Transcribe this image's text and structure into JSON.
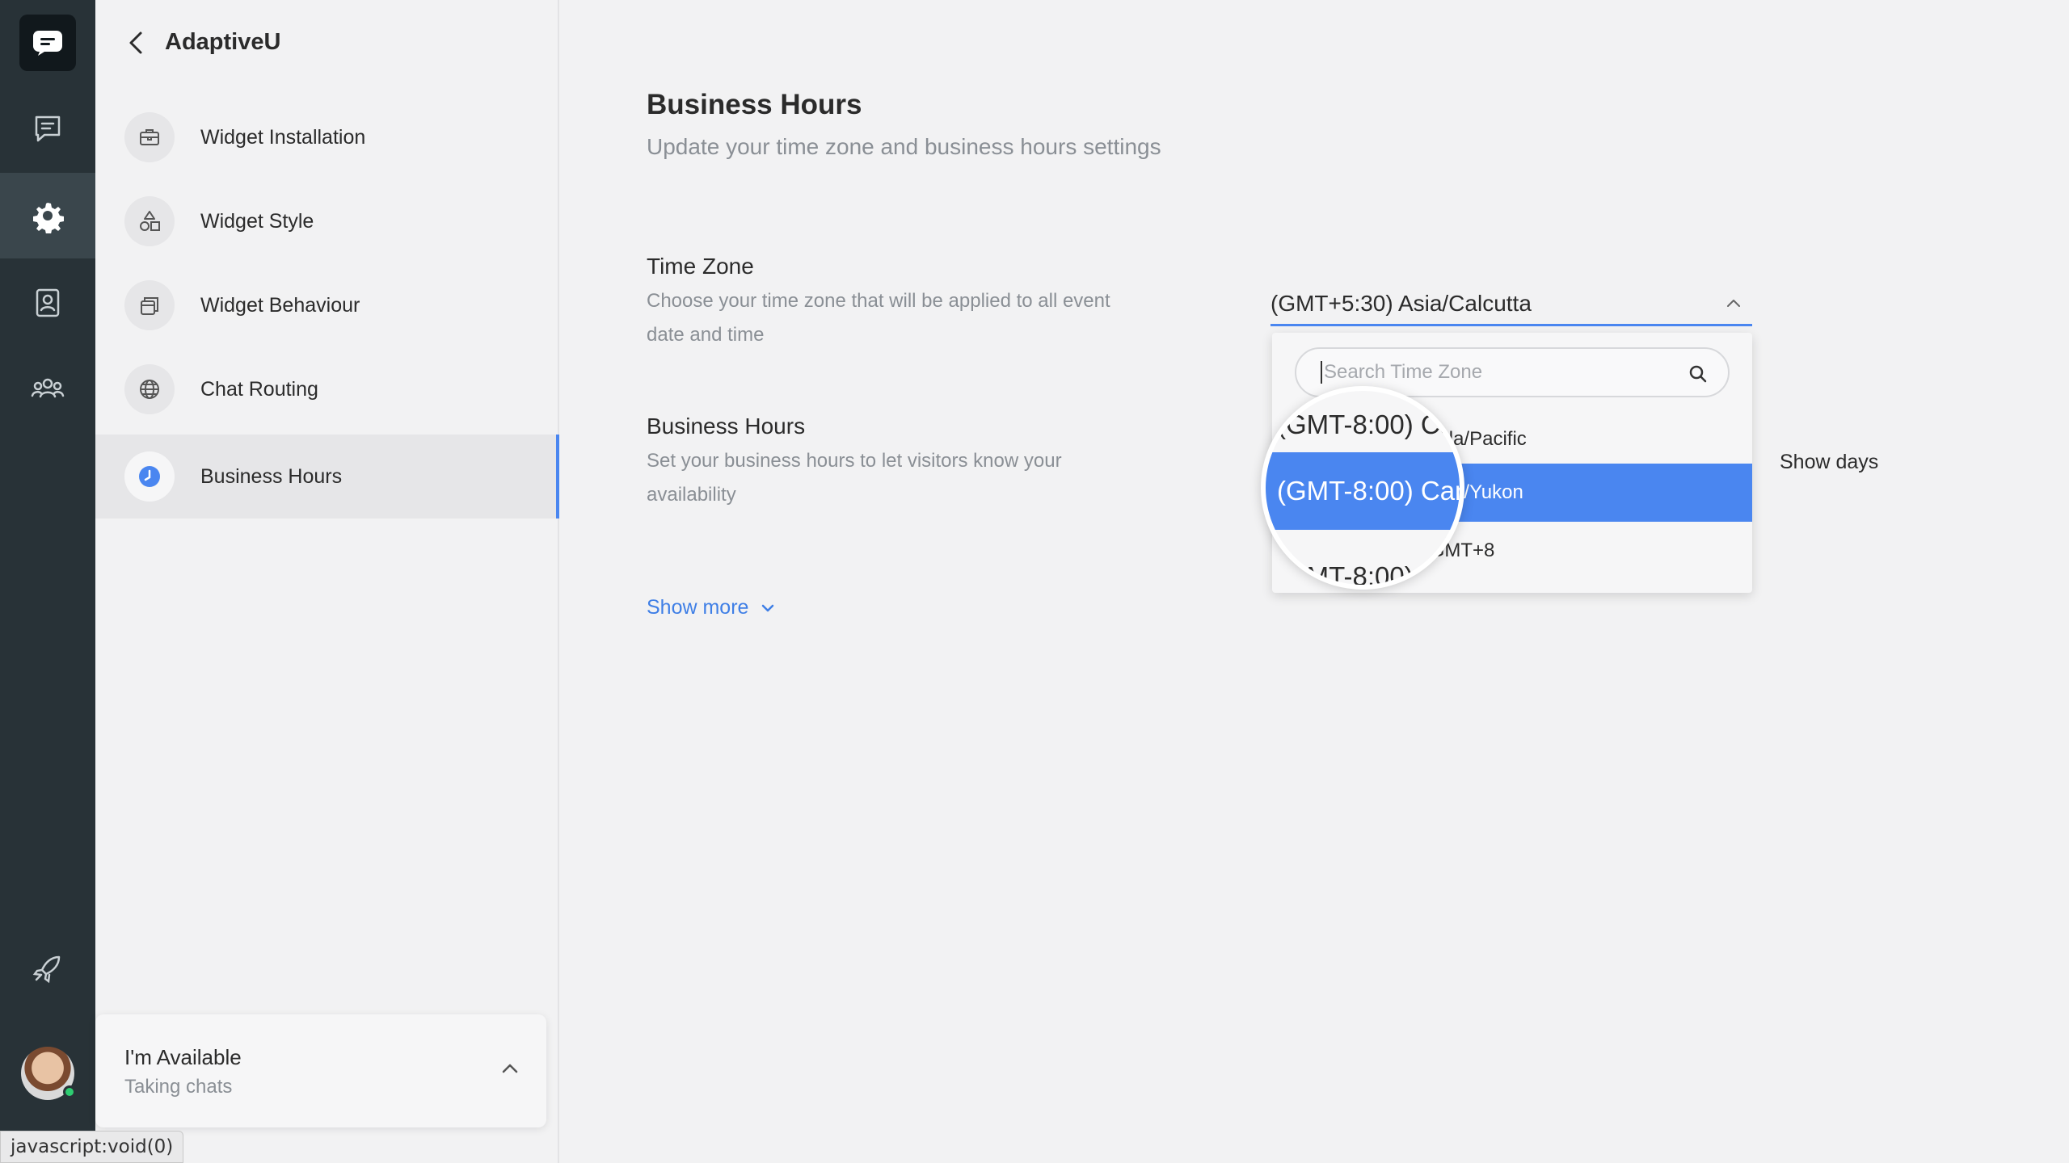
{
  "rail": {
    "items": [
      {
        "name": "chat-icon"
      },
      {
        "name": "settings-gear-icon"
      },
      {
        "name": "contacts-icon"
      },
      {
        "name": "team-icon"
      },
      {
        "name": "rocket-icon"
      }
    ]
  },
  "sidebar": {
    "title": "AdaptiveU",
    "items": [
      {
        "label": "Widget Installation",
        "icon": "briefcase-icon"
      },
      {
        "label": "Widget Style",
        "icon": "shapes-icon"
      },
      {
        "label": "Widget Behaviour",
        "icon": "layers-icon"
      },
      {
        "label": "Chat Routing",
        "icon": "globe-icon"
      },
      {
        "label": "Business Hours",
        "icon": "clock-icon"
      }
    ]
  },
  "availability": {
    "title": "I'm Available",
    "subtitle": "Taking chats"
  },
  "status_bar": "javascript:void(0)",
  "main": {
    "title": "Business Hours",
    "subtitle": "Update your time zone and business hours settings",
    "timezone": {
      "title": "Time Zone",
      "description": "Choose your time zone that will be applied to all event date and time",
      "selected": "(GMT+5:30) Asia/Calcutta"
    },
    "business_hours": {
      "title": "Business Hours",
      "description": "Set your business hours to let visitors know your availability"
    },
    "show_days": "Show days",
    "show_more": "Show more"
  },
  "dropdown": {
    "search_placeholder": "Search Time Zone",
    "options": [
      {
        "label": "(GMT-8:00) Canada/Pacific",
        "selected": false
      },
      {
        "label": "(GMT-8:00) Canada/Yukon",
        "selected": true
      },
      {
        "label": "(GMT-8:00) Etc/GMT+8",
        "selected": false
      }
    ]
  },
  "colors": {
    "accent": "#4a86f0",
    "rail": "#283237",
    "online": "#2ecc71"
  }
}
